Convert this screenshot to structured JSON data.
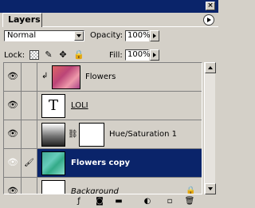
{
  "panel": {
    "title_close": "×",
    "tab_label": "Layers"
  },
  "controls": {
    "blend_mode": "Normal",
    "opacity_label": "Opacity:",
    "opacity_value": "100%",
    "lock_label": "Lock:",
    "fill_label": "Fill:",
    "fill_value": "100%"
  },
  "icons": {
    "lock_transparency": "transparency-lock-icon",
    "lock_image": "brush-lock-icon",
    "lock_position": "move-lock-icon",
    "lock_all": "lock-icon"
  },
  "layers": [
    {
      "name": "Flowers",
      "visible": true,
      "type": "image-clipped",
      "selected": false
    },
    {
      "name": "LOLI",
      "visible": true,
      "type": "text",
      "selected": false
    },
    {
      "name": "Hue/Saturation 1",
      "visible": true,
      "type": "adjustment",
      "selected": false
    },
    {
      "name": "Flowers copy",
      "visible": true,
      "type": "image",
      "selected": true
    },
    {
      "name": "Background",
      "visible": true,
      "type": "background",
      "selected": false
    }
  ],
  "text_thumb_glyph": "T",
  "colors": {
    "selected_row": "#0a246a",
    "panel_bg": "#d4d0c8"
  }
}
